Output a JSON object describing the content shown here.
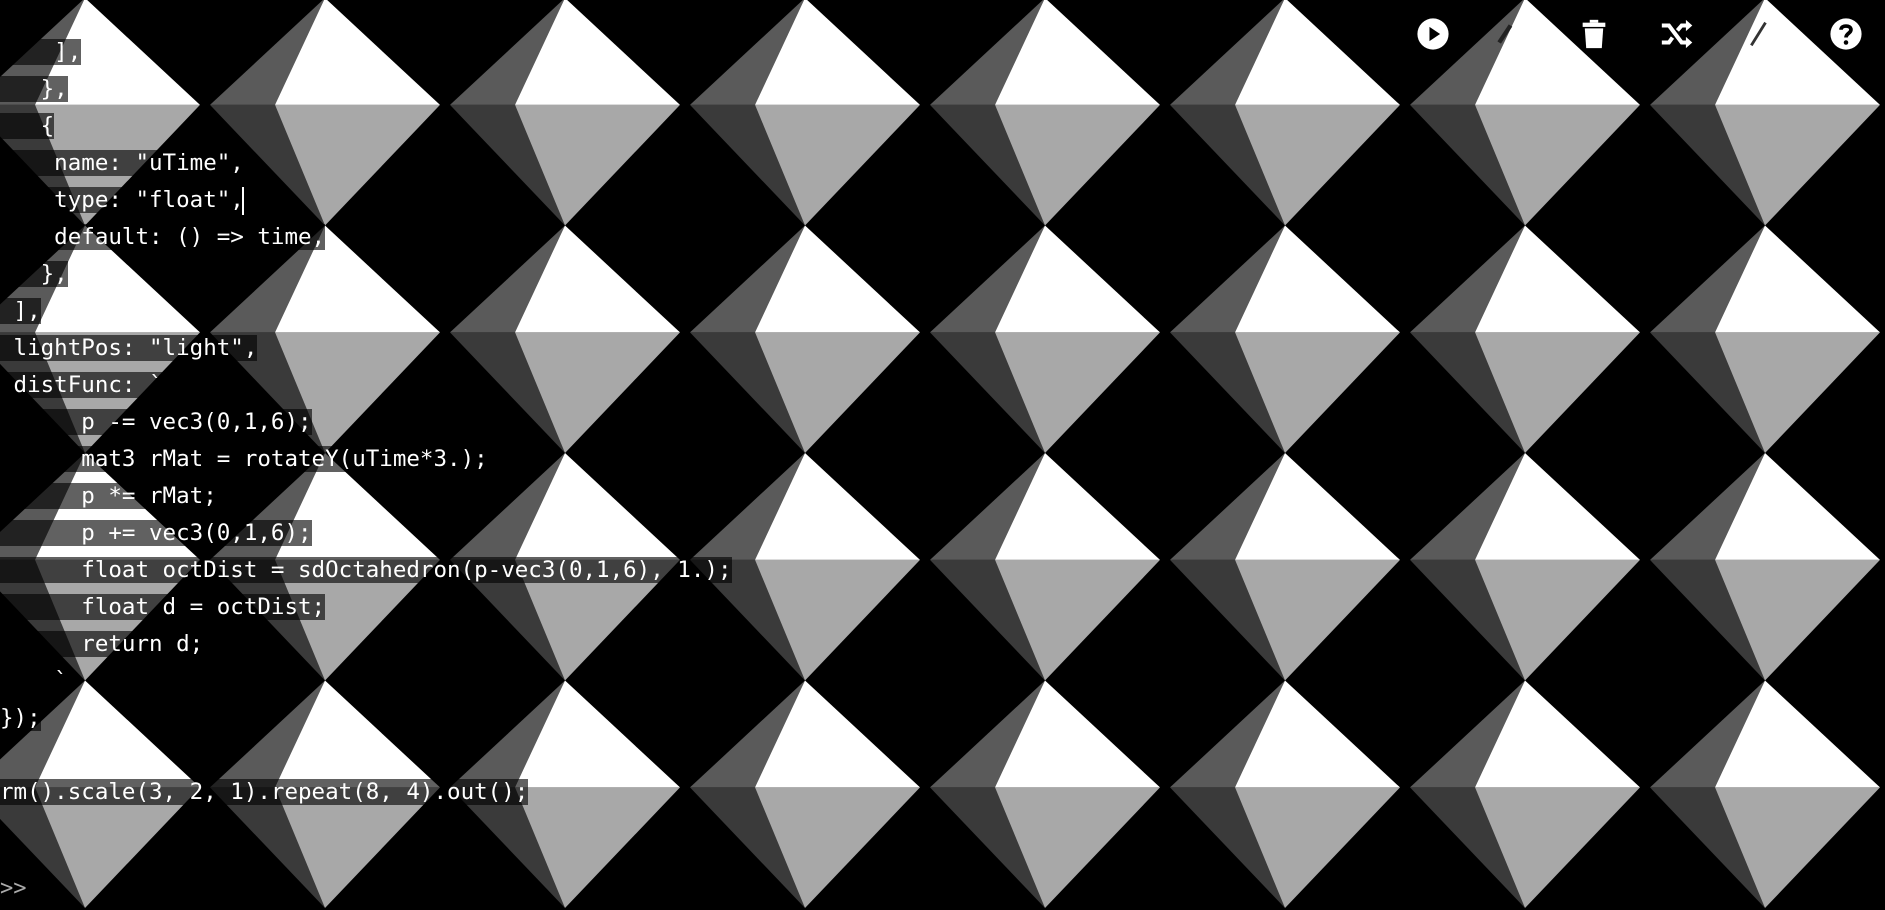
{
  "toolbar": {
    "buttons": [
      {
        "id": "run",
        "icon": "play-circle-icon"
      },
      {
        "id": "hidden-left",
        "icon": "share-icon"
      },
      {
        "id": "clear",
        "icon": "trash-icon"
      },
      {
        "id": "shuffle",
        "icon": "shuffle-icon"
      },
      {
        "id": "hidden-right",
        "icon": "feather-icon"
      },
      {
        "id": "help",
        "icon": "help-circle-icon"
      }
    ]
  },
  "editor": {
    "lines": [
      "    ],",
      "   },",
      "   {",
      "    name: \"uTime\",",
      "    type: \"float\",",
      "    default: () => time,",
      "   },",
      " ],",
      " lightPos: \"light\",",
      " distFunc: `",
      "      p -= vec3(0,1,6);",
      "      mat3 rMat = rotateY(uTime*3.);",
      "      p *= rMat;",
      "      p += vec3(0,1,6);",
      "      float octDist = sdOctahedron(p-vec3(0,1,6), 1.);",
      "      float d = octDist;",
      "      return d;",
      "    `",
      "});",
      "",
      "rm().scale(3, 2, 1).repeat(8, 4).out();"
    ]
  },
  "prompt": ">>",
  "colors": {
    "background": "#000000",
    "key": "#9fe0a7",
    "string": "#ffd870",
    "number": "#c792ea"
  }
}
